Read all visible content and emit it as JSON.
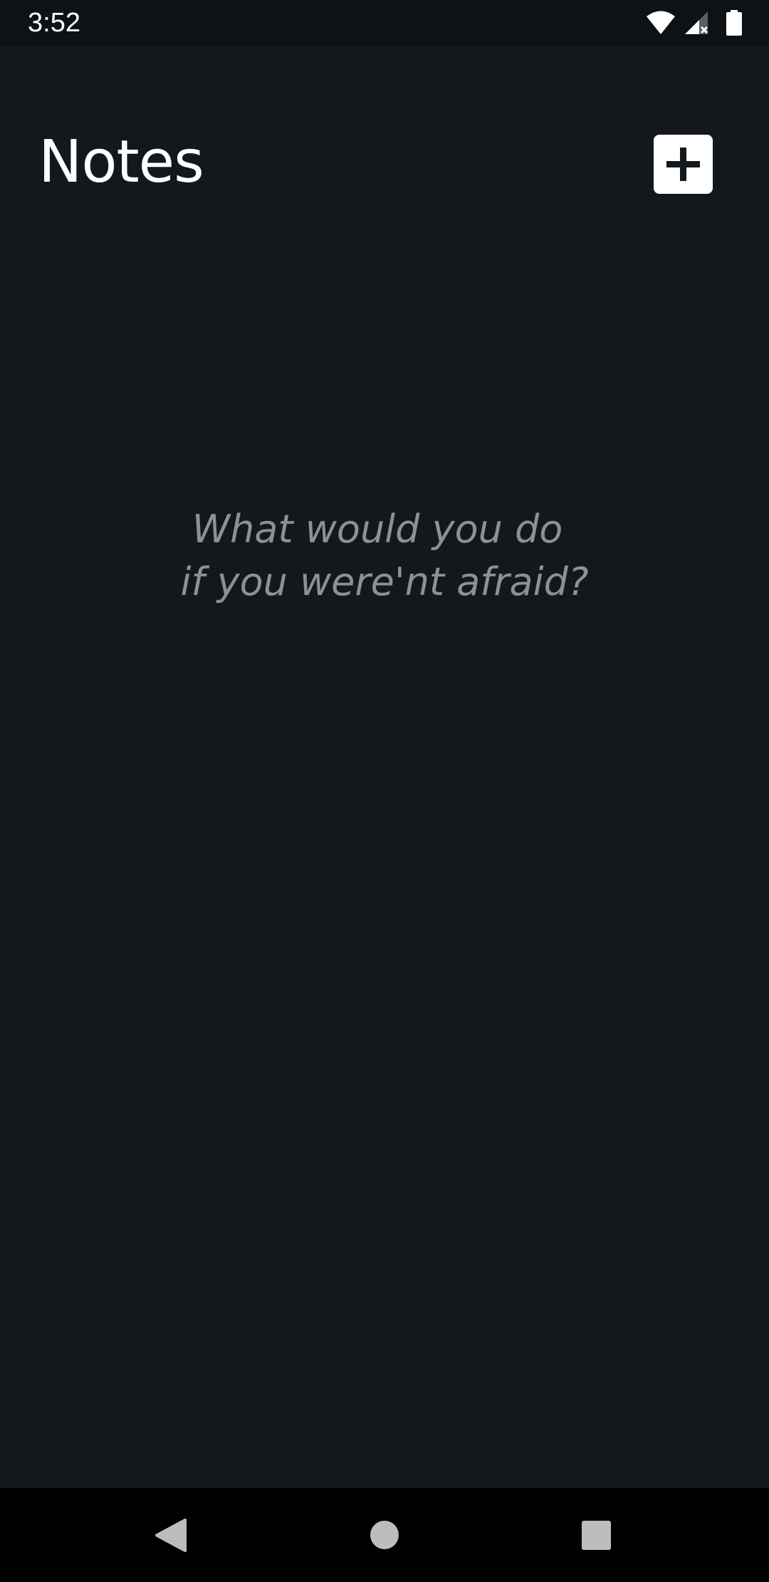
{
  "status_bar": {
    "time": "3:52",
    "icons": [
      "wifi-icon",
      "cellular-no-signal-icon",
      "battery-icon"
    ]
  },
  "header": {
    "title": "Notes",
    "add_button_icon": "plus-icon"
  },
  "empty_state": {
    "line1": "What would you do",
    "line2": "if you were'nt afraid?"
  },
  "nav_bar": {
    "buttons": [
      "back-icon",
      "home-icon",
      "recents-icon"
    ]
  },
  "colors": {
    "background": "#13181d",
    "status_bar": "#0e1216",
    "title_text": "#ffffff",
    "quote_text": "#8c9196",
    "add_button_bg": "#ffffff",
    "nav_bar": "#000000"
  }
}
